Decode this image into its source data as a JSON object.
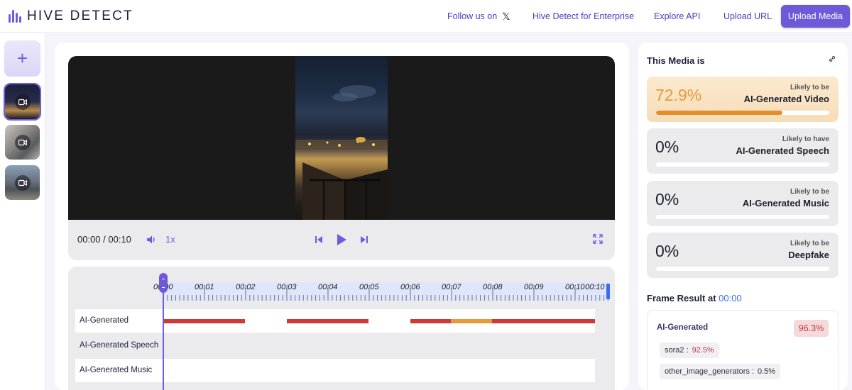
{
  "brand": {
    "name": "HIVE DETECT"
  },
  "nav": {
    "follow": "Follow us on",
    "follow_icon": "x-logo-icon",
    "enterprise": "Hive Detect for Enterprise",
    "api": "Explore API",
    "upload_url": "Upload URL",
    "upload_media": "Upload Media"
  },
  "sidebar": {
    "add_label": "+",
    "thumbnails": [
      {
        "name": "media-thumbnail-1",
        "active": true
      },
      {
        "name": "media-thumbnail-2",
        "active": false
      },
      {
        "name": "media-thumbnail-3",
        "active": false
      }
    ]
  },
  "player": {
    "time": "00:00 / 00:10",
    "speed": "1x",
    "icons": [
      "volume-icon",
      "skip-back-icon",
      "play-icon",
      "skip-forward-icon",
      "fullscreen-icon"
    ]
  },
  "timeline": {
    "ticks": [
      "00:00",
      "00:01",
      "00:02",
      "00:03",
      "00:04",
      "00:05",
      "00:06",
      "00:07",
      "00:08",
      "00:09",
      "00:10",
      "00:10"
    ],
    "rows": [
      {
        "label": "AI-Generated"
      },
      {
        "label": "AI-Generated Speech"
      },
      {
        "label": "AI-Generated Music"
      }
    ],
    "colors": {
      "red": "#cf3a36",
      "orange": "#e79a3b",
      "playhead": "#6b5ce0"
    }
  },
  "results": {
    "title": "This Media is",
    "items": [
      {
        "pct": "72.9%",
        "small": "Likely to be",
        "big": "AI-Generated Video",
        "value": 0.729
      },
      {
        "pct": "0%",
        "small": "Likely to have",
        "big": "AI-Generated Speech",
        "value": 0
      },
      {
        "pct": "0%",
        "small": "Likely to be",
        "big": "AI-Generated Music",
        "value": 0
      },
      {
        "pct": "0%",
        "small": "Likely to be",
        "big": "Deepfake",
        "value": 0
      }
    ]
  },
  "frame_result": {
    "title": "Frame Result at",
    "time": "00:00",
    "label": "AI-Generated",
    "score": "96.3%",
    "chips": [
      {
        "key": "sora2 :",
        "value": "92.5%"
      },
      {
        "key": "other_image_generators :",
        "value": "0.5%"
      }
    ]
  }
}
